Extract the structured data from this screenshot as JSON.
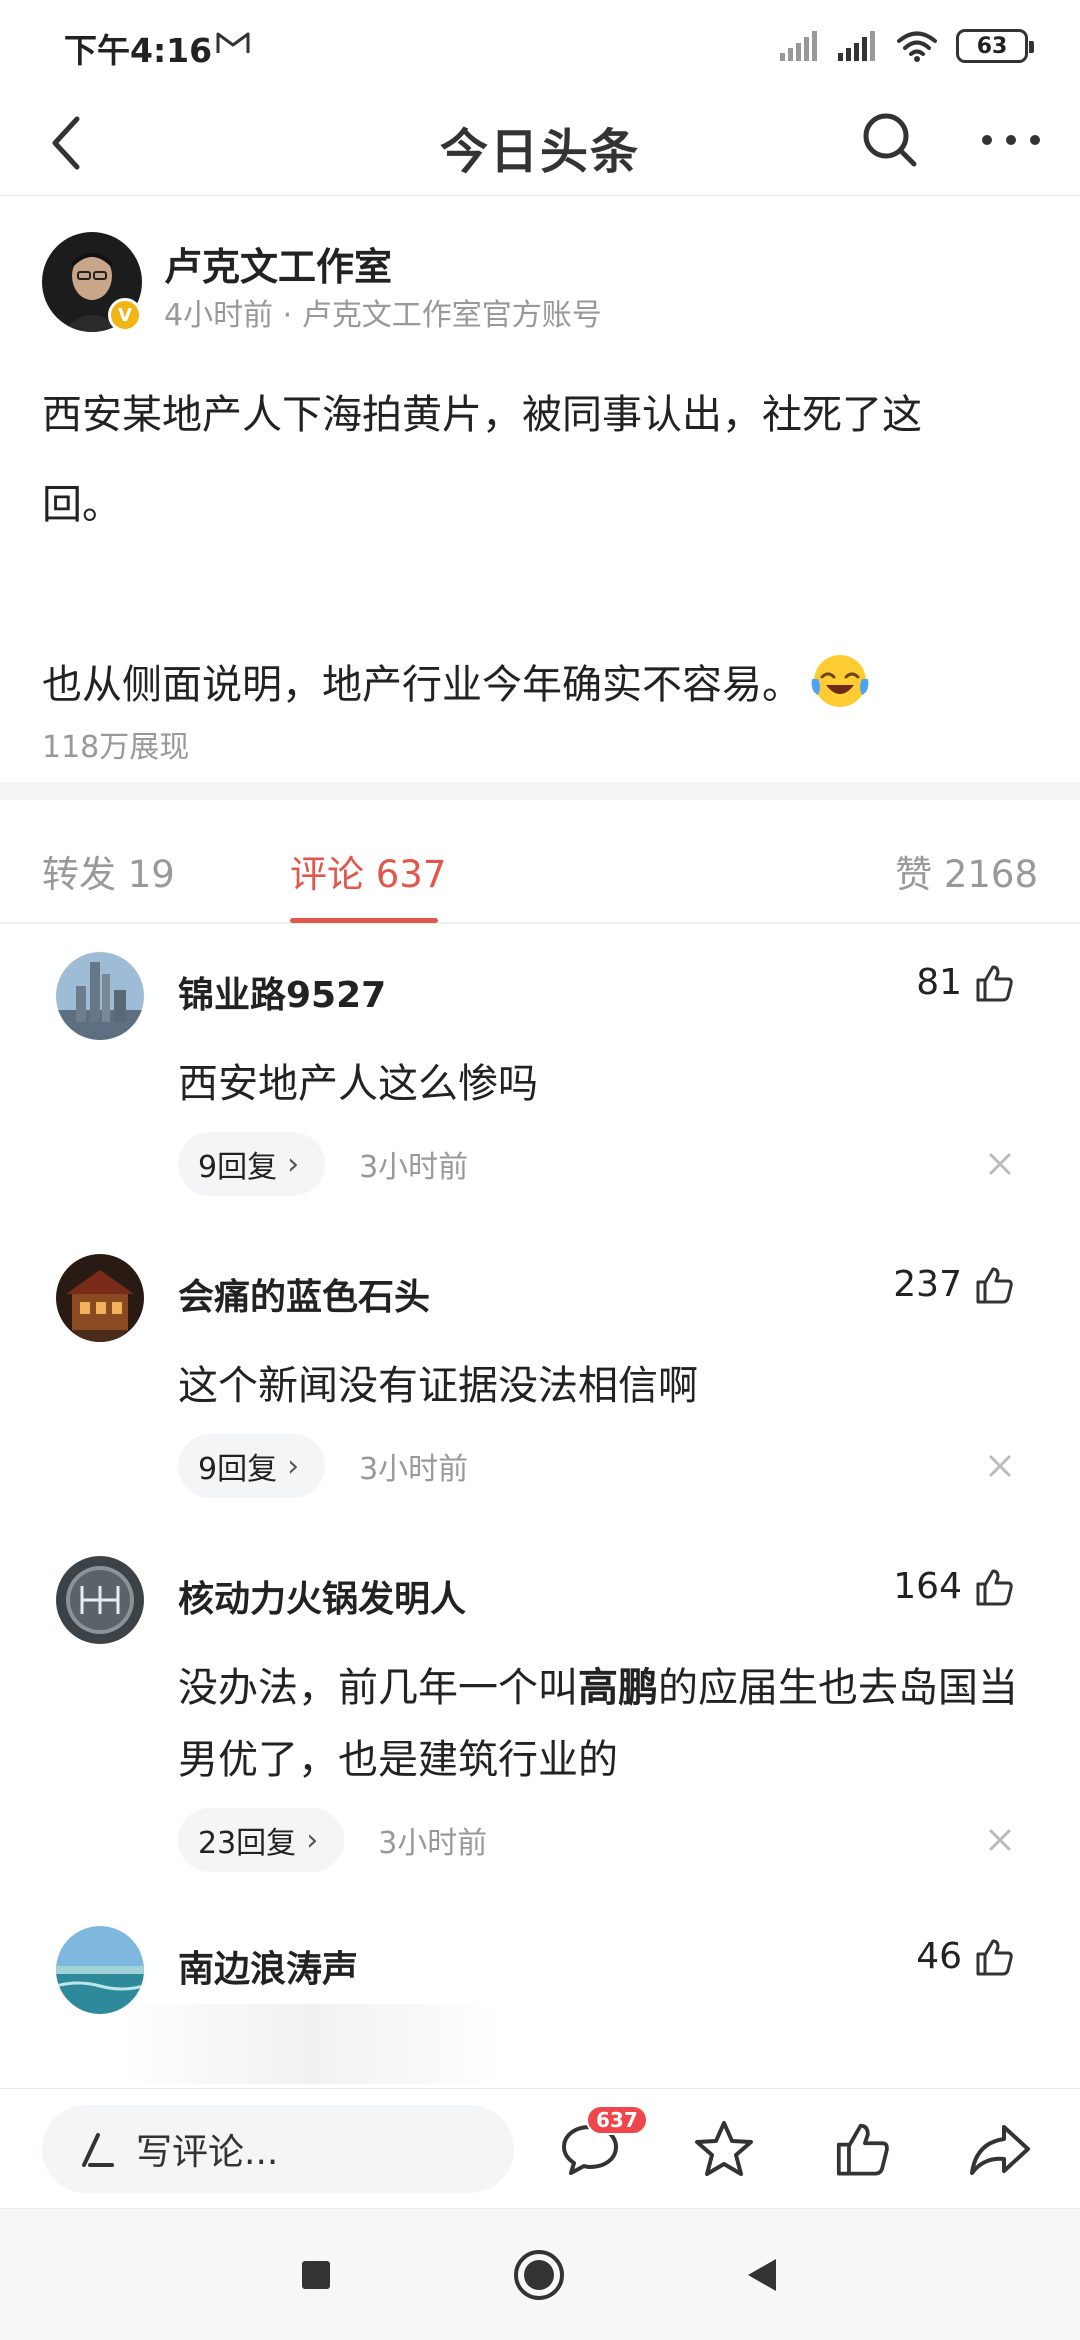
{
  "status_bar": {
    "time": "下午4:16",
    "battery": "63"
  },
  "header": {
    "title": "今日头条"
  },
  "post": {
    "author_name": "卢克文工作室",
    "author_meta": "4小时前 · 卢克文工作室官方账号",
    "badge": "V",
    "body_lines": [
      "西安某地产人下海拍黄片，被同事认出，社死了这",
      "回。",
      "",
      "也从侧面说明，地产行业今年确实不容易。"
    ],
    "views": "118万展现"
  },
  "tabs": {
    "repost": "转发 19",
    "comments": "评论 637",
    "likes": "赞 2168"
  },
  "comments": [
    {
      "user": "锦业路9527",
      "likes": "81",
      "text": "西安地产人这么惨吗",
      "replies": "9回复",
      "time": "3小时前"
    },
    {
      "user": "会痛的蓝色石头",
      "likes": "237",
      "text": "这个新闻没有证据没法相信啊",
      "replies": "9回复",
      "time": "3小时前"
    },
    {
      "user": "核动力火锅发明人",
      "likes": "164",
      "text_before": "没办法，前几年一个叫",
      "text_bold": "高鹏",
      "text_after": "的应届生也去岛国当男优了，也是建筑行业的",
      "replies": "23回复",
      "time": "3小时前"
    },
    {
      "user": "南边浪涛声",
      "likes": "46"
    }
  ],
  "action_bar": {
    "input_placeholder": "写评论...",
    "comment_count": "637"
  },
  "colors": {
    "accent": "#e2574c",
    "badge_red": "#f0454a",
    "verified_gold": "#f1b616",
    "muted_text": "#999999"
  }
}
